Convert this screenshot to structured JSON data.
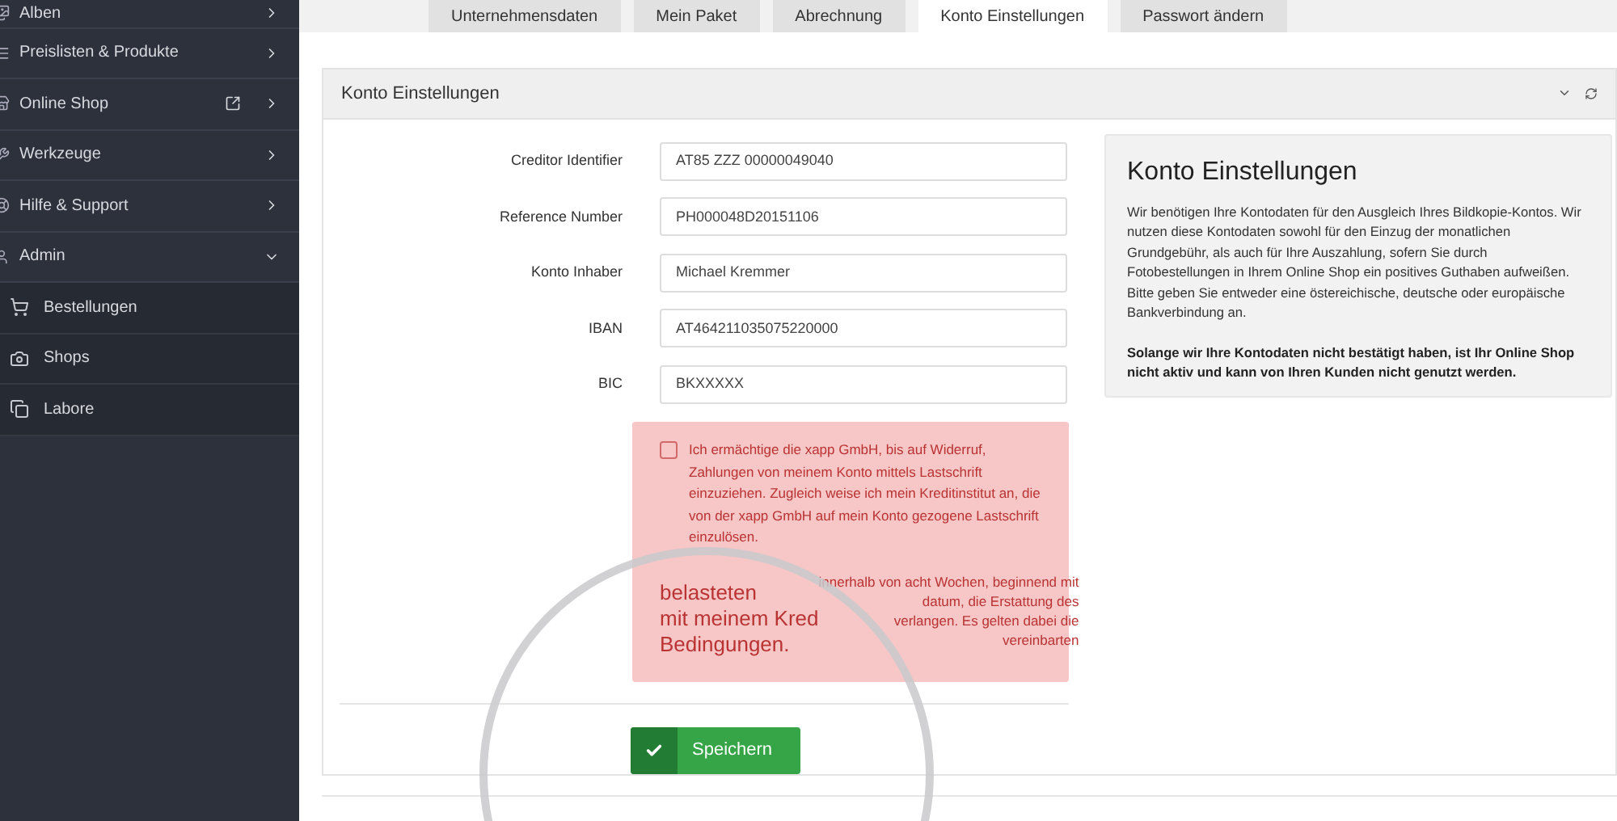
{
  "sidebar": {
    "items": [
      {
        "label": "Alben",
        "expanded": false
      },
      {
        "label": "Preislisten & Produkte",
        "expanded": false
      },
      {
        "label": "Online Shop",
        "expanded": false
      },
      {
        "label": "Werkzeuge",
        "expanded": false
      },
      {
        "label": "Hilfe & Support",
        "expanded": false
      },
      {
        "label": "Admin",
        "expanded": true,
        "children": [
          {
            "label": "Bestellungen"
          },
          {
            "label": "Shops"
          },
          {
            "label": "Labore"
          }
        ]
      }
    ]
  },
  "tabs": [
    {
      "label": "Unternehmensdaten",
      "selected": false
    },
    {
      "label": "Mein Paket",
      "selected": false
    },
    {
      "label": "Abrechnung",
      "selected": false
    },
    {
      "label": "Konto Einstellungen",
      "selected": true
    },
    {
      "label": "Passwort ändern",
      "selected": false
    }
  ],
  "panel": {
    "title": "Konto Einstellungen",
    "fields": [
      {
        "label": "Creditor Identifier",
        "value": "AT85 ZZZ 00000049040"
      },
      {
        "label": "Reference Number",
        "value": "PH000048D20151106"
      },
      {
        "label": "Konto Inhaber",
        "value": "Michael Kremmer"
      },
      {
        "label": "IBAN",
        "value": "AT464211035075220000"
      },
      {
        "label": "BIC",
        "value": "BKXXXXX"
      }
    ],
    "mandate": {
      "checked": false,
      "text": "Ich ermächtige die xapp GmbH, bis auf Widerruf, Zahlungen von meinem Konto mittels Lastschrift einzuziehen. Zugleich weise ich mein Kreditinstitut an, die von der xapp GmbH auf mein Konto gezogene Lastschrift einzulösen.",
      "fragments": [
        "innerhalb von acht Wochen, beginnend mit",
        "datum, die Erstattung des",
        "verlangen. Es gelten dabei die",
        "vereinbarten"
      ],
      "magnified": [
        "belasteten",
        "mit meinem Kred",
        "Bedingungen."
      ]
    },
    "save_button": "Speichern",
    "info": {
      "title": "Konto Einstellungen",
      "text": "Wir benötigen Ihre Kontodaten für den Ausgleich Ihres Bildkopie-Kontos. Wir nutzen diese Kontodaten sowohl für den Einzug der monatlichen Grundgebühr, als auch für Ihre Auszahlung, sofern Sie durch Fotobestellungen in Ihrem Online Shop ein positives Guthaben aufweißen. Bitte geben Sie entweder eine östereichische, deutsche oder europäische Bankverbindung an.",
      "note": "Solange wir Ihre Kontodaten nicht bestätigt haben, ist Ihr Online Shop nicht aktiv und kann von Ihren Kunden nicht genutzt werden."
    }
  }
}
